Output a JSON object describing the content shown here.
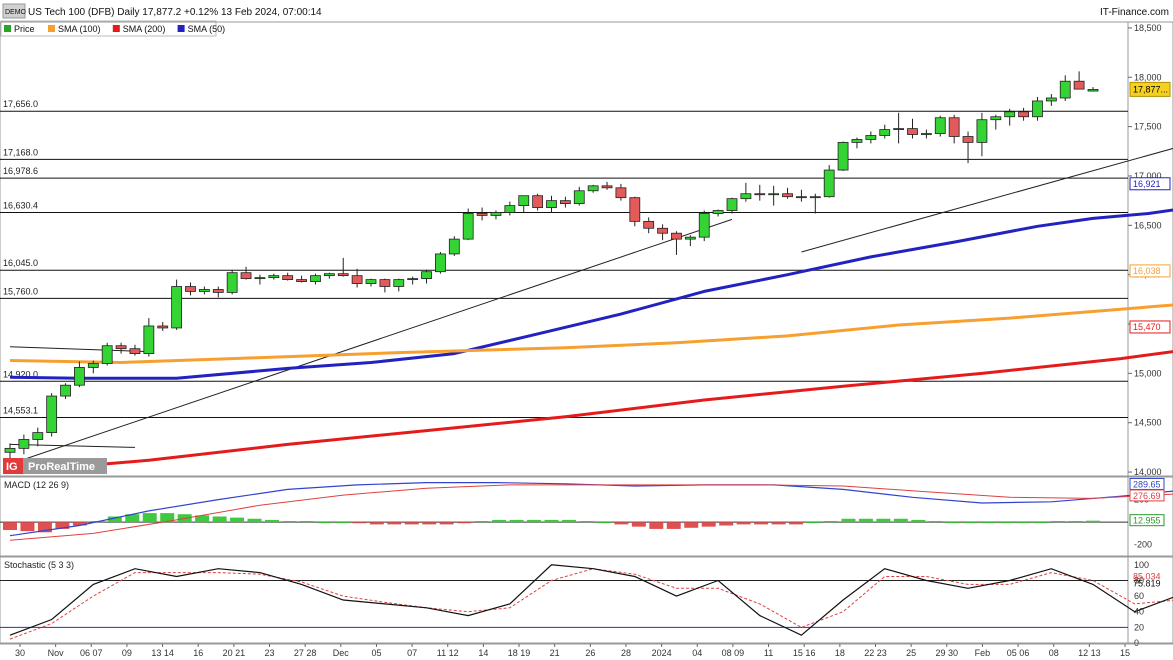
{
  "header": {
    "badge": "DEMO",
    "title": "US Tech 100 (DFB) Daily 17,877.2 +0.12% 13 Feb 2024, 07:00:14",
    "brand": "IT-Finance.com"
  },
  "legend": [
    {
      "label": "Price",
      "color": "#2aa52a"
    },
    {
      "label": "SMA (100)",
      "color": "#f7a030"
    },
    {
      "label": "SMA (200)",
      "color": "#e51b1b"
    },
    {
      "label": "SMA (50)",
      "color": "#2222c0"
    }
  ],
  "watermark": {
    "logo": "IG",
    "text": "ProRealTime"
  },
  "chart_data": [
    {
      "type": "candlestick",
      "title": "US Tech 100 (DFB) Daily",
      "ylim": [
        13960,
        18560
      ],
      "y_ticks": [
        14000,
        14500,
        15000,
        15500,
        16000,
        16500,
        17000,
        17500,
        18000,
        18500
      ],
      "x_ticks": [
        "30",
        "Nov",
        "06 07",
        "09",
        "13 14",
        "16",
        "20 21",
        "23",
        "27 28",
        "Dec",
        "05",
        "07",
        "11 12",
        "14",
        "18 19",
        "21",
        "26",
        "28",
        "2024",
        "04",
        "08 09",
        "11",
        "15 16",
        "18",
        "22 23",
        "25",
        "29 30",
        "Feb",
        "05 06",
        "08",
        "12 13",
        "15"
      ],
      "candles": [
        [
          14200,
          14290,
          14140,
          14240
        ],
        [
          14240,
          14380,
          14180,
          14330
        ],
        [
          14330,
          14450,
          14260,
          14400
        ],
        [
          14400,
          14800,
          14360,
          14770
        ],
        [
          14770,
          14900,
          14740,
          14880
        ],
        [
          14880,
          15120,
          14860,
          15060
        ],
        [
          15060,
          15130,
          15000,
          15100
        ],
        [
          15100,
          15310,
          15080,
          15280
        ],
        [
          15280,
          15310,
          15200,
          15250
        ],
        [
          15250,
          15290,
          15180,
          15200
        ],
        [
          15200,
          15560,
          15170,
          15480
        ],
        [
          15480,
          15520,
          15430,
          15460
        ],
        [
          15460,
          15950,
          15440,
          15880
        ],
        [
          15880,
          15920,
          15790,
          15830
        ],
        [
          15830,
          15880,
          15800,
          15850
        ],
        [
          15850,
          15880,
          15770,
          15820
        ],
        [
          15820,
          16050,
          15800,
          16020
        ],
        [
          16020,
          16080,
          15950,
          15960
        ],
        [
          15960,
          16000,
          15900,
          15970
        ],
        [
          15970,
          16010,
          15950,
          15990
        ],
        [
          15990,
          16020,
          15940,
          15950
        ],
        [
          15950,
          15990,
          15920,
          15930
        ],
        [
          15930,
          16010,
          15900,
          15990
        ],
        [
          15990,
          16020,
          15960,
          16010
        ],
        [
          16010,
          16170,
          15980,
          15990
        ],
        [
          15990,
          16060,
          15870,
          15910
        ],
        [
          15910,
          15960,
          15880,
          15950
        ],
        [
          15950,
          15960,
          15820,
          15880
        ],
        [
          15880,
          15960,
          15830,
          15950
        ],
        [
          15950,
          15980,
          15900,
          15960
        ],
        [
          15960,
          16050,
          15910,
          16030
        ],
        [
          16030,
          16230,
          16010,
          16210
        ],
        [
          16210,
          16390,
          16190,
          16360
        ],
        [
          16360,
          16670,
          16350,
          16620
        ],
        [
          16620,
          16680,
          16550,
          16600
        ],
        [
          16600,
          16650,
          16560,
          16630
        ],
        [
          16630,
          16740,
          16600,
          16700
        ],
        [
          16700,
          16800,
          16630,
          16800
        ],
        [
          16800,
          16820,
          16650,
          16680
        ],
        [
          16680,
          16800,
          16630,
          16750
        ],
        [
          16750,
          16790,
          16680,
          16720
        ],
        [
          16720,
          16890,
          16700,
          16850
        ],
        [
          16850,
          16910,
          16830,
          16900
        ],
        [
          16900,
          16940,
          16860,
          16880
        ],
        [
          16880,
          16920,
          16750,
          16780
        ],
        [
          16780,
          16790,
          16490,
          16540
        ],
        [
          16540,
          16580,
          16420,
          16470
        ],
        [
          16470,
          16510,
          16350,
          16420
        ],
        [
          16420,
          16440,
          16200,
          16360
        ],
        [
          16360,
          16400,
          16290,
          16380
        ],
        [
          16380,
          16650,
          16340,
          16620
        ],
        [
          16620,
          16660,
          16590,
          16650
        ],
        [
          16650,
          16780,
          16620,
          16770
        ],
        [
          16770,
          16930,
          16740,
          16820
        ],
        [
          16820,
          16910,
          16750,
          16810
        ],
        [
          16810,
          16900,
          16700,
          16820
        ],
        [
          16820,
          16880,
          16770,
          16790
        ],
        [
          16790,
          16860,
          16740,
          16780
        ],
        [
          16780,
          16820,
          16620,
          16790
        ],
        [
          16790,
          17110,
          16780,
          17060
        ],
        [
          17060,
          17350,
          17050,
          17340
        ],
        [
          17340,
          17390,
          17280,
          17370
        ],
        [
          17370,
          17450,
          17330,
          17410
        ],
        [
          17410,
          17520,
          17380,
          17470
        ],
        [
          17470,
          17640,
          17330,
          17480
        ],
        [
          17480,
          17580,
          17380,
          17420
        ],
        [
          17420,
          17470,
          17380,
          17430
        ],
        [
          17430,
          17610,
          17400,
          17590
        ],
        [
          17590,
          17620,
          17330,
          17400
        ],
        [
          17400,
          17450,
          17130,
          17340
        ],
        [
          17340,
          17640,
          17200,
          17570
        ],
        [
          17570,
          17620,
          17470,
          17600
        ],
        [
          17600,
          17680,
          17510,
          17650
        ],
        [
          17650,
          17690,
          17560,
          17600
        ],
        [
          17600,
          17800,
          17560,
          17760
        ],
        [
          17760,
          17830,
          17710,
          17790
        ],
        [
          17790,
          18020,
          17760,
          17960
        ],
        [
          17960,
          18060,
          17890,
          17880
        ],
        [
          17860,
          17900,
          17860,
          17877
        ]
      ],
      "horizontal_levels": [
        "17,656.0",
        "17,168.0",
        "16,978.6",
        "16,630.4",
        "16,045.0",
        "15,760.0",
        "14,920.0",
        "14,553.1"
      ],
      "horizontal_level_values": [
        17656.0,
        17168.0,
        16978.6,
        16630.4,
        16045.0,
        15760.0,
        14920.0,
        14553.1
      ],
      "current_price_label": "17,877...",
      "current_price": 17877.2,
      "series": [
        {
          "name": "SMA (50)",
          "color": "#2222c0",
          "points": [
            [
              0,
              14960
            ],
            [
              5,
              14950
            ],
            [
              12,
              14950
            ],
            [
              20,
              15050
            ],
            [
              26,
              15110
            ],
            [
              32,
              15200
            ],
            [
              38,
              15400
            ],
            [
              44,
              15600
            ],
            [
              50,
              15830
            ],
            [
              56,
              16000
            ],
            [
              62,
              16180
            ],
            [
              68,
              16330
            ],
            [
              74,
              16490
            ],
            [
              78,
              16570
            ],
            [
              82,
              16620
            ],
            [
              86,
              16700
            ],
            [
              90,
              16840
            ],
            [
              94,
              16921
            ]
          ],
          "end_label": "16,921"
        },
        {
          "name": "SMA (100)",
          "color": "#f7a030",
          "points": [
            [
              0,
              15130
            ],
            [
              8,
              15110
            ],
            [
              16,
              15150
            ],
            [
              28,
              15210
            ],
            [
              40,
              15260
            ],
            [
              48,
              15310
            ],
            [
              56,
              15380
            ],
            [
              64,
              15490
            ],
            [
              72,
              15560
            ],
            [
              80,
              15650
            ],
            [
              88,
              15740
            ],
            [
              94,
              16038
            ]
          ],
          "end_label": "16,038"
        },
        {
          "name": "SMA (200)",
          "color": "#e51b1b",
          "points": [
            [
              0,
              14000
            ],
            [
              10,
              14120
            ],
            [
              20,
              14280
            ],
            [
              30,
              14420
            ],
            [
              40,
              14560
            ],
            [
              50,
              14730
            ],
            [
              60,
              14870
            ],
            [
              70,
              15000
            ],
            [
              80,
              15150
            ],
            [
              88,
              15300
            ],
            [
              94,
              15470
            ]
          ],
          "end_label": "15,470"
        }
      ],
      "trendlines": [
        [
          [
            0,
            14080
          ],
          [
            52,
            16560
          ]
        ],
        [
          [
            57,
            16230
          ],
          [
            94,
            17680
          ]
        ],
        [
          [
            0,
            15270
          ],
          [
            10,
            15220
          ]
        ],
        [
          [
            0,
            14280
          ],
          [
            9,
            14250
          ]
        ]
      ]
    },
    {
      "type": "bar",
      "title": "MACD (12 26 9)",
      "ylim": [
        -300,
        400
      ],
      "y_ticks_labels": [
        "200",
        "0",
        "-200"
      ],
      "y_ticks": [
        200,
        0,
        -200
      ],
      "macd_label": "289.65",
      "signal_label": "276.69",
      "histogram_label": "12.955",
      "macd_line": [
        [
          0,
          -120
        ],
        [
          5,
          -30
        ],
        [
          10,
          100
        ],
        [
          15,
          200
        ],
        [
          20,
          290
        ],
        [
          25,
          330
        ],
        [
          30,
          350
        ],
        [
          35,
          350
        ],
        [
          40,
          340
        ],
        [
          45,
          320
        ],
        [
          50,
          330
        ],
        [
          55,
          330
        ],
        [
          60,
          290
        ],
        [
          65,
          220
        ],
        [
          70,
          170
        ],
        [
          75,
          180
        ],
        [
          80,
          230
        ],
        [
          85,
          290
        ],
        [
          90,
          300
        ],
        [
          94,
          289.65
        ]
      ],
      "signal_line": [
        [
          0,
          -160
        ],
        [
          6,
          -100
        ],
        [
          12,
          20
        ],
        [
          18,
          150
        ],
        [
          24,
          240
        ],
        [
          30,
          300
        ],
        [
          36,
          330
        ],
        [
          42,
          330
        ],
        [
          48,
          330
        ],
        [
          54,
          330
        ],
        [
          60,
          320
        ],
        [
          66,
          270
        ],
        [
          72,
          220
        ],
        [
          78,
          210
        ],
        [
          84,
          250
        ],
        [
          90,
          280
        ],
        [
          94,
          276.69
        ]
      ],
      "histogram": [
        -70,
        -80,
        -90,
        -60,
        -30,
        10,
        50,
        70,
        80,
        80,
        70,
        60,
        50,
        40,
        30,
        20,
        10,
        10,
        0,
        0,
        -10,
        -20,
        -20,
        -20,
        -20,
        -20,
        -10,
        10,
        20,
        20,
        20,
        20,
        20,
        10,
        0,
        -20,
        -40,
        -60,
        -60,
        -50,
        -40,
        -30,
        -20,
        -20,
        -20,
        -20,
        0,
        10,
        30,
        30,
        30,
        30,
        20,
        10,
        0,
        0,
        0,
        0,
        0,
        0,
        10,
        10,
        12.955
      ]
    },
    {
      "type": "line",
      "title": "Stochastic (5 3 3)",
      "ylim": [
        0,
        110
      ],
      "y_ticks": [
        100,
        80,
        60,
        40,
        20,
        0
      ],
      "k_label": "85.034",
      "d_label": "75.819",
      "k_line": [
        [
          0,
          10
        ],
        [
          3,
          30
        ],
        [
          6,
          75
        ],
        [
          9,
          95
        ],
        [
          12,
          85
        ],
        [
          15,
          95
        ],
        [
          18,
          90
        ],
        [
          21,
          75
        ],
        [
          24,
          55
        ],
        [
          27,
          50
        ],
        [
          30,
          45
        ],
        [
          33,
          35
        ],
        [
          36,
          50
        ],
        [
          39,
          100
        ],
        [
          42,
          95
        ],
        [
          45,
          85
        ],
        [
          48,
          60
        ],
        [
          51,
          80
        ],
        [
          54,
          35
        ],
        [
          57,
          10
        ],
        [
          60,
          55
        ],
        [
          63,
          95
        ],
        [
          66,
          80
        ],
        [
          69,
          70
        ],
        [
          72,
          80
        ],
        [
          75,
          95
        ],
        [
          78,
          75
        ],
        [
          81,
          40
        ],
        [
          84,
          60
        ],
        [
          87,
          95
        ],
        [
          90,
          90
        ],
        [
          93,
          75
        ]
      ],
      "d_line": [
        [
          0,
          5
        ],
        [
          3,
          25
        ],
        [
          6,
          60
        ],
        [
          9,
          90
        ],
        [
          12,
          90
        ],
        [
          15,
          90
        ],
        [
          18,
          88
        ],
        [
          21,
          78
        ],
        [
          24,
          60
        ],
        [
          27,
          52
        ],
        [
          30,
          45
        ],
        [
          33,
          40
        ],
        [
          36,
          45
        ],
        [
          39,
          80
        ],
        [
          42,
          95
        ],
        [
          45,
          88
        ],
        [
          48,
          70
        ],
        [
          51,
          70
        ],
        [
          54,
          50
        ],
        [
          57,
          20
        ],
        [
          60,
          40
        ],
        [
          63,
          85
        ],
        [
          66,
          85
        ],
        [
          69,
          75
        ],
        [
          72,
          75
        ],
        [
          75,
          90
        ],
        [
          78,
          80
        ],
        [
          81,
          50
        ],
        [
          84,
          55
        ],
        [
          87,
          85
        ],
        [
          90,
          92
        ],
        [
          93,
          85.034
        ]
      ]
    }
  ]
}
